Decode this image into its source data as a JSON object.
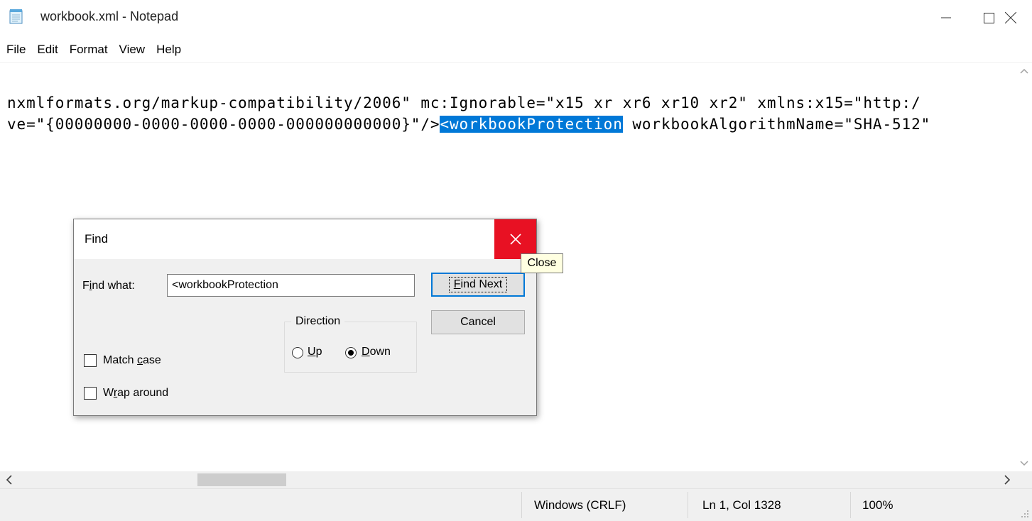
{
  "window": {
    "title": "workbook.xml - Notepad"
  },
  "menu": [
    "File",
    "Edit",
    "Format",
    "View",
    "Help"
  ],
  "editor": {
    "line1": "nxmlformats.org/markup-compatibility/2006\" mc:Ignorable=\"x15 xr xr6 xr10 xr2\" xmlns:x15=\"http:/",
    "line2_before": "ve=\"{00000000-0000-0000-0000-000000000000}\"/>",
    "line2_selected": "<workbookProtection",
    "line2_after": " workbookAlgorithmName=\"SHA-512\""
  },
  "statusbar": {
    "line_ending": "Windows (CRLF)",
    "position": "Ln 1, Col 1328",
    "zoom": "100%"
  },
  "find_dialog": {
    "title": "Find",
    "find_what_label_pre": "F",
    "find_what_label_u": "i",
    "find_what_label_post": "nd what:",
    "find_what_value": "<workbookProtection",
    "find_next_u": "F",
    "find_next_rest": "ind Next",
    "cancel_label": "Cancel",
    "direction_label": "Direction",
    "up_u": "U",
    "up_rest": "p",
    "down_u": "D",
    "down_rest": "own",
    "direction_selected": "Down",
    "match_case_pre": "Match ",
    "match_case_u": "c",
    "match_case_post": "ase",
    "wrap_pre": "W",
    "wrap_u": "r",
    "wrap_post": "ap around",
    "close_tooltip": "Close"
  },
  "colors": {
    "selection": "#0078d7",
    "close_red": "#e81123",
    "tooltip_bg": "#ffffe1"
  }
}
